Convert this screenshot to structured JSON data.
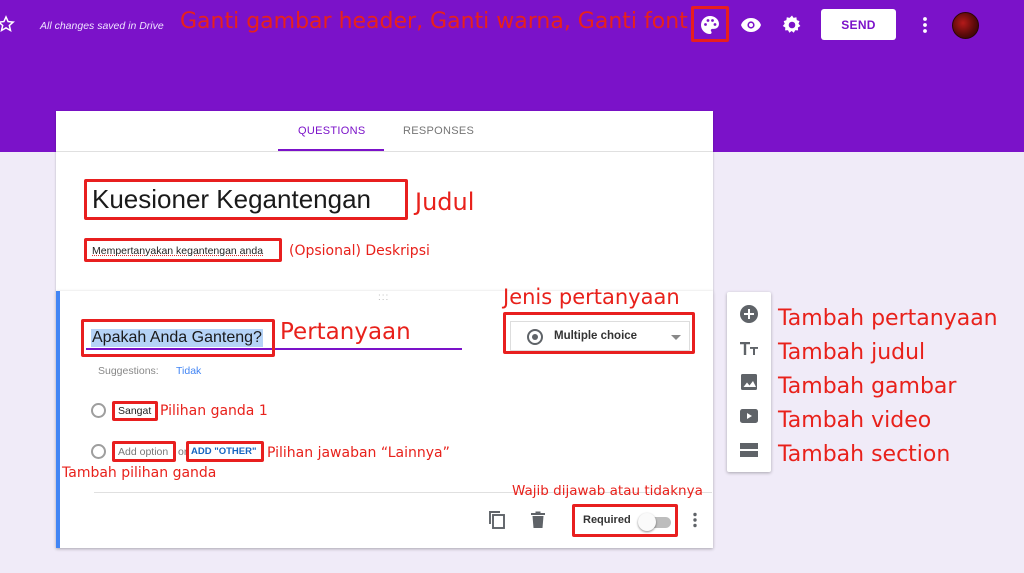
{
  "topbar": {
    "saved_text": "All changes saved in Drive",
    "send_label": "SEND",
    "palette_annotation": "Ganti gambar header, Ganti warna, Ganti font",
    "brand_color": "#7b12c9",
    "icons": [
      "star-icon",
      "palette-icon",
      "eye-icon",
      "gear-icon",
      "more-vert-icon"
    ]
  },
  "tabs": {
    "questions": "QUESTIONS",
    "responses": "RESPONSES"
  },
  "form": {
    "title": "Kuesioner Kegantengan",
    "title_annotation": "Judul",
    "description": "Mempertanyakan kegantengan anda",
    "description_annotation": "(Opsional) Deskripsi"
  },
  "question": {
    "title": "Apakah Anda Ganteng?",
    "title_annotation": "Pertanyaan",
    "type_label": "Multiple choice",
    "type_annotation": "Jenis pertanyaan",
    "suggestions_label": "Suggestions:",
    "suggestion": "Tidak",
    "option_1": "Sangat",
    "option_1_annotation": "Pilihan ganda 1",
    "add_option": "Add option",
    "or_text": "or",
    "add_other": "ADD \"OTHER\"",
    "add_other_annotation": "Pilihan jawaban “Lainnya”",
    "add_option_annotation": "Tambah pilihan ganda",
    "required_label": "Required",
    "required_on": false,
    "required_annotation": "Wajib dijawab atau tidaknya",
    "accent_color": "#4285f4"
  },
  "side_toolbar": {
    "items": [
      {
        "icon": "add-circle-icon",
        "label": "Tambah pertanyaan"
      },
      {
        "icon": "title-icon",
        "label": "Tambah judul"
      },
      {
        "icon": "image-icon",
        "label": "Tambah gambar"
      },
      {
        "icon": "video-icon",
        "label": "Tambah video"
      },
      {
        "icon": "section-icon",
        "label": "Tambah section"
      }
    ]
  },
  "annotation_color": "#e8211b"
}
